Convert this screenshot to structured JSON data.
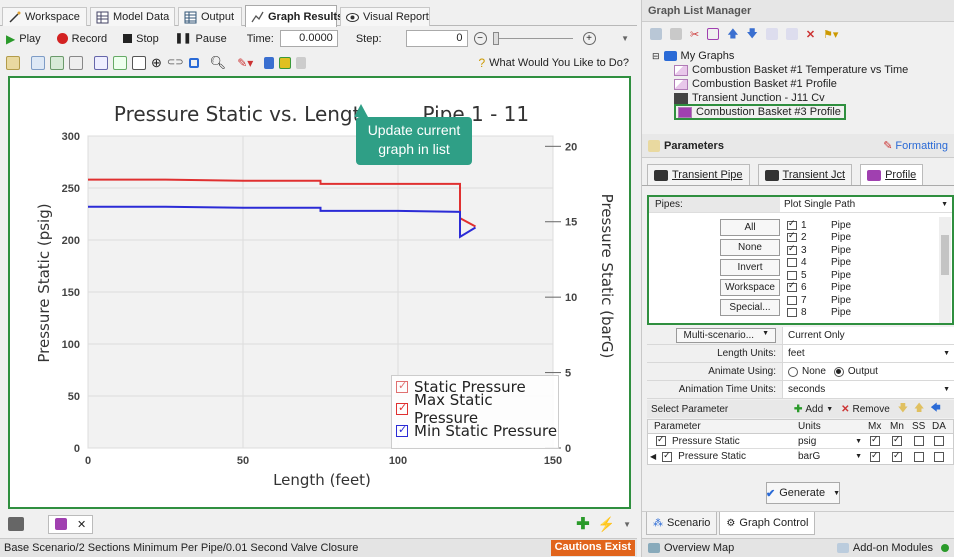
{
  "tabs": [
    {
      "label": "Workspace",
      "icon": "workspace-icon"
    },
    {
      "label": "Model Data",
      "icon": "model-data-icon"
    },
    {
      "label": "Output",
      "icon": "output-icon"
    },
    {
      "label": "Graph Results",
      "icon": "graph-results-icon",
      "active": true
    },
    {
      "label": "Visual Report",
      "icon": "visual-report-icon"
    }
  ],
  "toolbar": {
    "play": "Play",
    "record": "Record",
    "stop": "Stop",
    "pause": "Pause",
    "time_label": "Time:",
    "time_value": "0.0000",
    "step_label": "Step:",
    "step_value": "0",
    "help": "What Would You Like to Do?"
  },
  "chart": {
    "title": "Pressure Static vs. Length - Pipe 1 - 11",
    "title_visible": "Pressure Static vs. Lengt",
    "title_tail": "Pipe 1 - 11",
    "xlabel": "Length (feet)",
    "ylabel_left": "Pressure Static (psig)",
    "ylabel_right": "Pressure Static (barG)"
  },
  "chart_data": {
    "type": "line",
    "title": "Pressure Static vs. Length - Pipe 1 - 11",
    "xlabel": "Length (feet)",
    "ylabel": "Pressure Static (psig)",
    "y2label": "Pressure Static (barG)",
    "xlim": [
      0,
      150
    ],
    "ylim": [
      0,
      300
    ],
    "y2lim": [
      0,
      20.684
    ],
    "xticks": [
      "0",
      "50",
      "100",
      "150"
    ],
    "yticks": [
      "0",
      "50",
      "100",
      "150",
      "200",
      "250",
      "300"
    ],
    "y2ticks": [
      "0",
      "5",
      "10",
      "15",
      "20"
    ],
    "grid": true,
    "legend_position": "bottom-right",
    "series": [
      {
        "name": "Max Static Pressure",
        "color": "#e03030",
        "x": [
          0,
          25,
          50,
          75,
          75,
          100,
          120,
          120,
          125
        ],
        "y": [
          258,
          258,
          257,
          257,
          254,
          254,
          254,
          221,
          213
        ]
      },
      {
        "name": "Min Static Pressure",
        "color": "#2b2bd6",
        "x": [
          0,
          25,
          50,
          75,
          75,
          100,
          120,
          120,
          125
        ],
        "y": [
          232,
          232,
          231,
          231,
          228,
          228,
          227,
          203,
          212
        ]
      }
    ],
    "legend": [
      {
        "name": "Static Pressure",
        "color": "#e07070"
      },
      {
        "name": "Max Static Pressure",
        "color": "#e03030"
      },
      {
        "name": "Min Static Pressure",
        "color": "#2b2bd6"
      }
    ]
  },
  "callout": {
    "text": "Update current graph in list"
  },
  "bottom": {
    "status": "Base Scenario/2 Sections Minimum Per Pipe/0.01 Second Valve Closure",
    "caution": "Cautions Exist"
  },
  "glm": {
    "title": "Graph List Manager",
    "root": "My Graphs",
    "items": [
      "Combustion Basket #1 Temperature vs Time",
      "Combustion Basket #1 Profile",
      "Transient Junction - J11 Cv",
      "Combustion Basket #3 Profile"
    ]
  },
  "params": {
    "title": "Parameters",
    "formatting": "Formatting",
    "tabs": [
      "Transient Pipe",
      "Transient Jct",
      "Profile"
    ],
    "pipes_label": "Pipes:",
    "pipes_mode": "Plot Single Path",
    "buttons": [
      "All",
      "None",
      "Invert",
      "Workspace",
      "Special..."
    ],
    "pipe_list": [
      {
        "n": "1",
        "t": "Pipe",
        "c": true
      },
      {
        "n": "2",
        "t": "Pipe",
        "c": true
      },
      {
        "n": "3",
        "t": "Pipe",
        "c": true
      },
      {
        "n": "4",
        "t": "Pipe",
        "c": false
      },
      {
        "n": "5",
        "t": "Pipe",
        "c": false
      },
      {
        "n": "6",
        "t": "Pipe",
        "c": true
      },
      {
        "n": "7",
        "t": "Pipe",
        "c": false
      },
      {
        "n": "8",
        "t": "Pipe",
        "c": false
      }
    ],
    "multi_label": "Multi-scenario...",
    "multi_value": "Current Only",
    "length_label": "Length Units:",
    "length_value": "feet",
    "animate_label": "Animate Using:",
    "animate_none": "None",
    "animate_output": "Output",
    "anim_time_label": "Animation Time Units:",
    "anim_time_value": "seconds",
    "select_param": "Select Parameter",
    "add": "Add",
    "remove": "Remove",
    "grid_headers": [
      "Parameter",
      "Units",
      "Mx",
      "Mn",
      "SS",
      "DA"
    ],
    "grid_rows": [
      {
        "param": "Pressure Static",
        "units": "psig"
      },
      {
        "param": "Pressure Static",
        "units": "barG"
      }
    ],
    "generate": "Generate"
  },
  "right_tabs": [
    "Scenario",
    "Graph Control"
  ],
  "right_status": {
    "overview": "Overview Map",
    "addon": "Add-on Modules"
  }
}
